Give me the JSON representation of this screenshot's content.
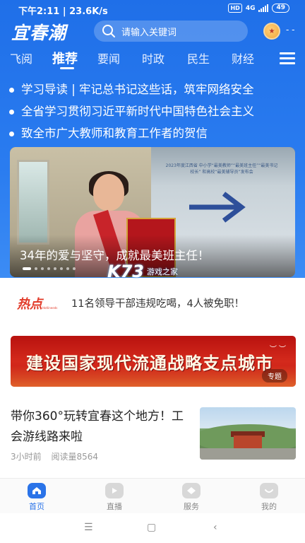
{
  "status_bar": {
    "time": "下午2:11 | 23.6K/s",
    "hd_label": "HD",
    "network": "4G",
    "battery": "49"
  },
  "header": {
    "logo": "宜春潮",
    "search_placeholder": "请输入关键词",
    "user_dash": "- -"
  },
  "tabs": [
    "飞阅",
    "推荐",
    "要闻",
    "时政",
    "民生",
    "财经"
  ],
  "active_tab": "推荐",
  "headlines": [
    "学习导读 | 牢记总书记这些话，筑牢网络安全",
    "全省学习贯彻习近平新时代中国特色社会主义",
    "致全市广大教师和教育工作者的贺信"
  ],
  "carousel": {
    "caption": "34年的爱与坚守，成就最美班主任！",
    "board_text": "2023年度江西省 中小学“最美教师”“最美班主任”“最美书记校长” 和高校“最美辅导员”发布会",
    "slide_count": 8,
    "active_slide": 1
  },
  "watermark": {
    "mark": "K73",
    "text": "游戏之家"
  },
  "hot": {
    "logo": "热点",
    "logo_sub": "Hotlineeds",
    "text": "11名领导干部违规吃喝，4人被免职！"
  },
  "banner": {
    "title": "建设国家现代流通战略支点城市",
    "tag": "专题"
  },
  "article": {
    "title": "带你360°玩转宜春这个地方！工会游线路来啦",
    "time": "3小时前",
    "reads": "阅读量8564"
  },
  "bottom_nav": [
    {
      "label": "首页",
      "icon": "home-icon",
      "active": true
    },
    {
      "label": "直播",
      "icon": "live-icon",
      "active": false
    },
    {
      "label": "服务",
      "icon": "service-icon",
      "active": false
    },
    {
      "label": "我的",
      "icon": "profile-icon",
      "active": false
    }
  ],
  "colors": {
    "brand_blue": "#2a73e8",
    "banner_red": "#c8201a",
    "hot_red": "#e23c2b"
  }
}
